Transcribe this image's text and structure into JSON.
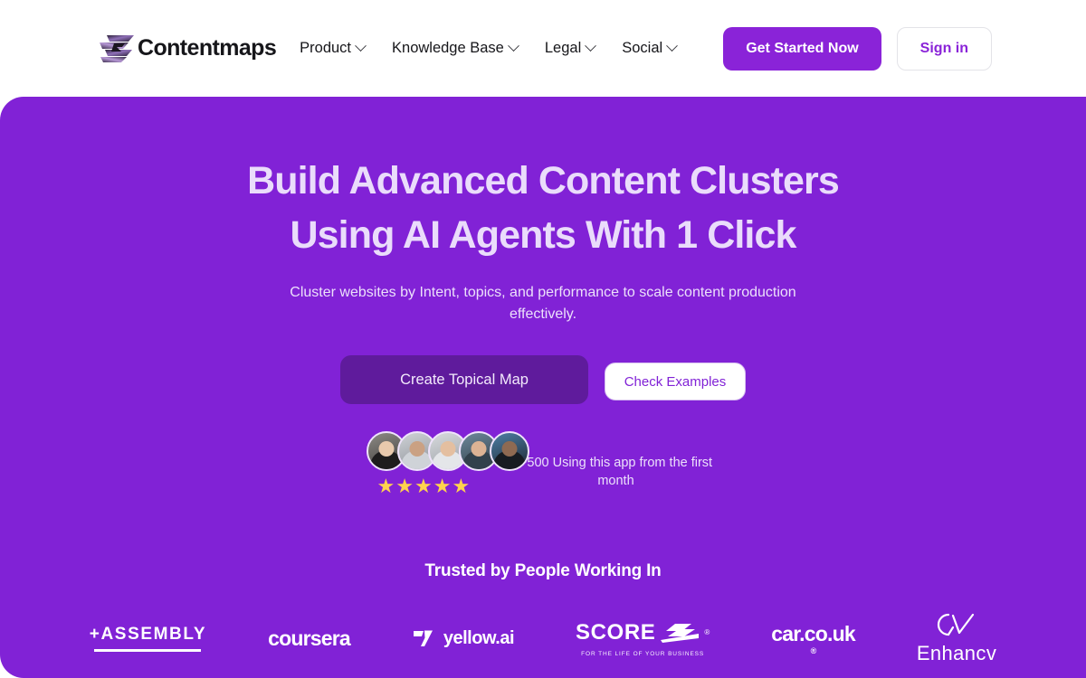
{
  "header": {
    "brand": {
      "name": "Contentmaps",
      "logo_icon": "contentmaps-logo-icon"
    },
    "nav": [
      {
        "label": "Product",
        "has_dropdown": true
      },
      {
        "label": "Knowledge Base",
        "has_dropdown": true
      },
      {
        "label": "Legal",
        "has_dropdown": true
      },
      {
        "label": "Social",
        "has_dropdown": true
      }
    ],
    "cta_primary": "Get Started Now",
    "cta_secondary": "Sign in"
  },
  "hero": {
    "title_line1": "Build Advanced Content Clusters",
    "title_line2": "Using AI Agents With 1 Click",
    "subtitle": "Cluster websites by Intent, topics, and performance to scale content production effectively.",
    "cta_primary": "Create Topical Map",
    "cta_secondary": "Check Examples",
    "social_proof": {
      "text": "+500 Using this app from the first month",
      "rating_stars": 5,
      "star_glyph": "★",
      "avatar_count": 5
    }
  },
  "trusted": {
    "title": "Trusted by People Working In",
    "logos": [
      {
        "name": "Assembly",
        "word": "ASSEMBLY",
        "prefix": "+"
      },
      {
        "name": "Coursera",
        "word": "coursera"
      },
      {
        "name": "yellow.ai",
        "word": "yellow.ai"
      },
      {
        "name": "SCORE",
        "word": "SCORE",
        "tagline": "FOR THE LIFE OF YOUR BUSINESS"
      },
      {
        "name": "car.co.uk",
        "word": "car.co.uk"
      },
      {
        "name": "Enhancv",
        "word": "Enhancv"
      }
    ]
  },
  "colors": {
    "brand_purple": "#8122d6",
    "header_purple": "#8a23d8",
    "hero_cta_purple": "#5f1b9c",
    "star_gold": "#ffd34d",
    "title_lavender": "#eadcfb"
  }
}
